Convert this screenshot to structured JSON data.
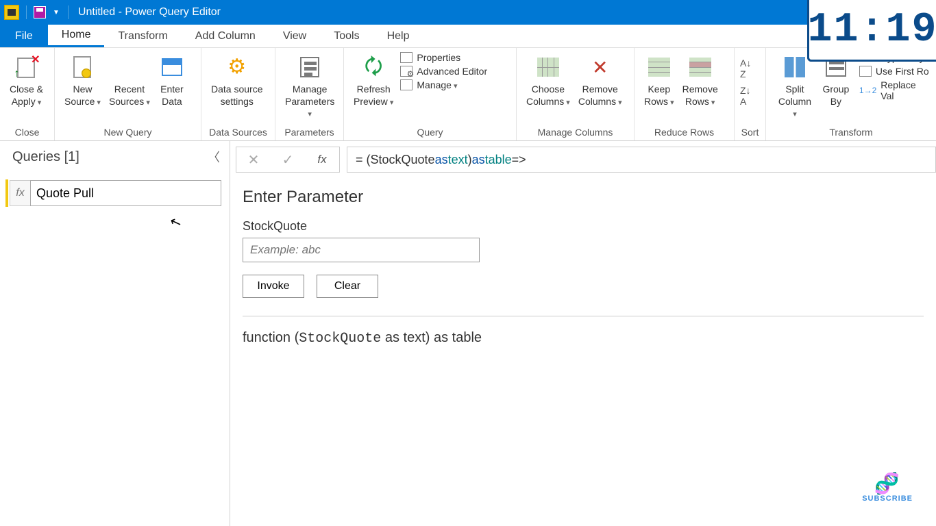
{
  "titlebar": {
    "title": "Untitled - Power Query Editor"
  },
  "menu": {
    "file": "File",
    "tabs": [
      "Home",
      "Transform",
      "Add Column",
      "View",
      "Tools",
      "Help"
    ],
    "active": "Home"
  },
  "ribbon": {
    "close": {
      "close_apply": "Close &\nApply",
      "group": "Close"
    },
    "newquery": {
      "new_source": "New\nSource",
      "recent_sources": "Recent\nSources",
      "enter_data": "Enter\nData",
      "group": "New Query"
    },
    "datasources": {
      "settings": "Data source\nsettings",
      "group": "Data Sources"
    },
    "parameters": {
      "manage": "Manage\nParameters",
      "group": "Parameters"
    },
    "query": {
      "refresh": "Refresh\nPreview",
      "properties": "Properties",
      "advanced": "Advanced Editor",
      "manage": "Manage",
      "group": "Query"
    },
    "managecols": {
      "choose": "Choose\nColumns",
      "remove": "Remove\nColumns",
      "group": "Manage Columns"
    },
    "reducerows": {
      "keep": "Keep\nRows",
      "remove": "Remove\nRows",
      "group": "Reduce Rows"
    },
    "sort": {
      "group": "Sort"
    },
    "transform": {
      "split": "Split\nColumn",
      "group_by": "Group\nBy",
      "datatype": "Data Type: Any",
      "firstrow": "Use First Ro",
      "replace": "Replace Val",
      "group": "Transform"
    }
  },
  "queries": {
    "title": "Queries [1]",
    "item_value": "Quote Pull"
  },
  "formula": {
    "prefix": "= (",
    "p1": "StockQuote ",
    "kw_as1": "as",
    "type1": " text",
    "mid": ") ",
    "kw_as2": "as",
    "type2": " table",
    "suffix": " =>"
  },
  "param": {
    "title": "Enter Parameter",
    "label": "StockQuote",
    "placeholder": "Example: abc",
    "invoke": "Invoke",
    "clear": "Clear"
  },
  "signature": {
    "prefix": "function (",
    "name": "StockQuote",
    "suffix": " as text) as table"
  },
  "overlay": {
    "clock": "11:19",
    "subscribe": "SUBSCRIBE"
  }
}
